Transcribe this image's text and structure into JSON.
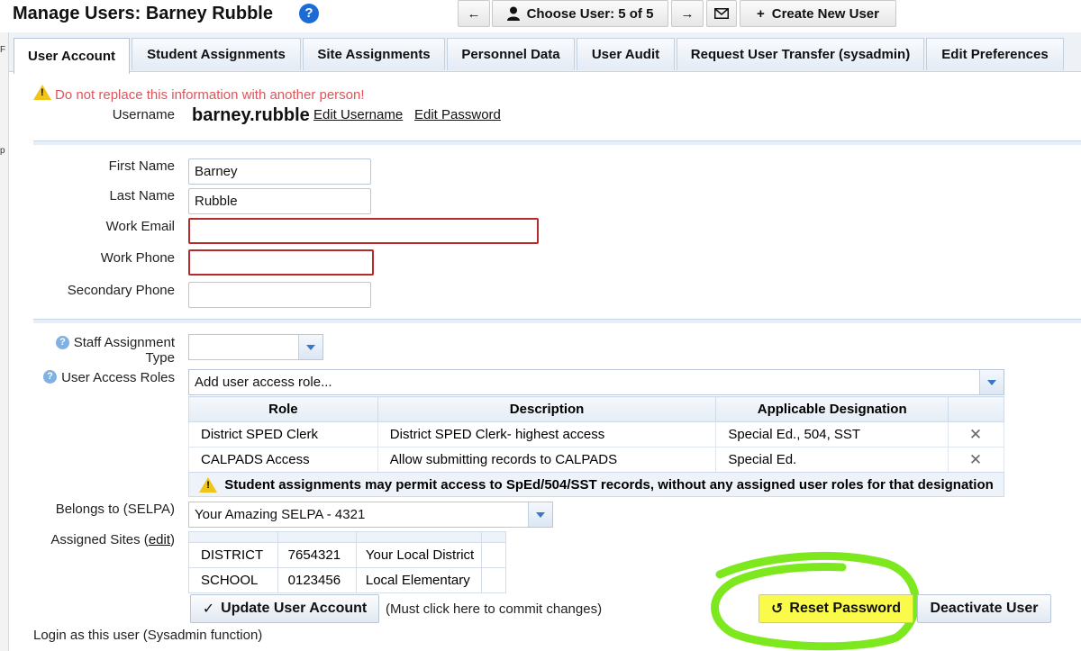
{
  "header": {
    "title": "Manage Users: Barney Rubble",
    "choose_user": "Choose User: 5 of 5",
    "create_new_user": "Create New User"
  },
  "left_strip": {
    "char1": "F",
    "char2": "p"
  },
  "tabs": [
    {
      "label": "User Account",
      "active": true
    },
    {
      "label": "Student Assignments"
    },
    {
      "label": "Site Assignments"
    },
    {
      "label": "Personnel Data"
    },
    {
      "label": "User Audit"
    },
    {
      "label": "Request User Transfer (sysadmin)"
    },
    {
      "label": "Edit Preferences"
    }
  ],
  "account": {
    "warning": "Do not replace this information with another person!",
    "username_label": "Username",
    "username": "barney.rubble",
    "edit_username": "Edit Username",
    "edit_password": "Edit Password"
  },
  "form": {
    "first_name_label": "First Name",
    "first_name": "Barney",
    "last_name_label": "Last Name",
    "last_name": "Rubble",
    "work_email_label": "Work Email",
    "work_email": "",
    "work_phone_label": "Work Phone",
    "work_phone": "",
    "secondary_phone_label": "Secondary Phone",
    "secondary_phone": ""
  },
  "roles_section": {
    "staff_assignment_label_1": "Staff Assignment",
    "staff_assignment_label_2": "Type",
    "staff_assignment_value": "",
    "user_access_roles_label": "User Access Roles",
    "add_role_placeholder": "Add user access role...",
    "columns": [
      "Role",
      "Description",
      "Applicable Designation"
    ],
    "rows": [
      {
        "role": "District SPED Clerk",
        "description": "District SPED Clerk- highest access",
        "designation": "Special Ed., 504, SST"
      },
      {
        "role": "CALPADS Access",
        "description": "Allow submitting records to CALPADS",
        "designation": "Special Ed."
      }
    ],
    "remove_glyph": "✕",
    "note": "Student assignments may permit access to SpEd/504/SST records, without any assigned user roles for that designation"
  },
  "selpa": {
    "label": "Belongs to (SELPA)",
    "value": "Your Amazing SELPA - 4321"
  },
  "sites": {
    "label_prefix": "Assigned Sites (",
    "label_link": "edit",
    "label_suffix": ")",
    "rows": [
      {
        "type": "DISTRICT",
        "code": "7654321",
        "name": "Your Local District"
      },
      {
        "type": "SCHOOL",
        "code": "0123456",
        "name": "Local Elementary"
      }
    ]
  },
  "actions": {
    "update": "Update User Account",
    "update_note": "(Must click here to commit changes)",
    "reset_password": "Reset Password",
    "deactivate": "Deactivate User",
    "login_as": "Login as this user (Sysadmin function)"
  },
  "colors": {
    "warning_text": "#e0555a",
    "error_border": "#b52a2a",
    "highlight_green": "#7ee81e",
    "highlight_yellow": "#ffff33",
    "help_blue": "#1c6bd6"
  }
}
